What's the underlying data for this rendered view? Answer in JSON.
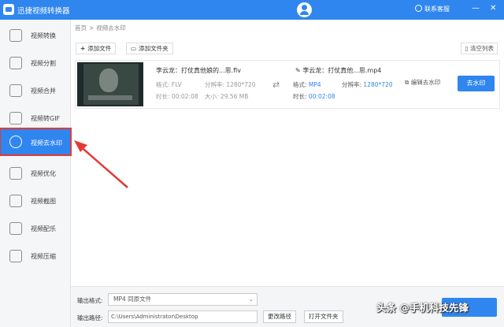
{
  "app": {
    "title": "迅捷视频转换器",
    "support_label": "联系客服",
    "win_min": "—",
    "win_close": "✕"
  },
  "sidebar": {
    "items": [
      {
        "label": "视频转换",
        "icon": "convert-icon"
      },
      {
        "label": "视频分割",
        "icon": "split-icon"
      },
      {
        "label": "视频合并",
        "icon": "merge-icon"
      },
      {
        "label": "视频转GIF",
        "icon": "gif-icon"
      },
      {
        "label": "视频去水印",
        "icon": "watermark-remove-icon",
        "active": true
      },
      {
        "label": "视频优化",
        "icon": "optimize-icon"
      },
      {
        "label": "视频截图",
        "icon": "screenshot-icon"
      },
      {
        "label": "视频配乐",
        "icon": "music-icon"
      },
      {
        "label": "视频压缩",
        "icon": "compress-icon"
      }
    ]
  },
  "breadcrumb": {
    "home": "首页",
    "sep": ">",
    "current": "视频去水印"
  },
  "toolbar": {
    "add_file": "添加文件",
    "add_folder": "添加文件夹",
    "clear_list": "清空列表"
  },
  "file": {
    "source_name": "李云龙：打仗真他娘的...思.flv",
    "format_label": "格式:",
    "format_value": "FLV",
    "resolution_label": "分辨率:",
    "resolution_value": "1280*720",
    "duration_label": "时长:",
    "duration_value": "00:02:08",
    "size_label": "大小:",
    "size_value": "29.56 MB",
    "output_name": "李云龙：打仗真他...思.mp4",
    "out_format_label": "格式:",
    "out_format_value": "MP4",
    "out_resolution_label": "分辨率:",
    "out_resolution_value": "1280*720",
    "out_duration_label": "时长:",
    "out_duration_value": "00:02:08",
    "edit_watermark": "编辑去水印",
    "remove_button": "去水印"
  },
  "bottom": {
    "format_label": "输出格式:",
    "format_value": "MP4 同原文件",
    "path_label": "输出路径:",
    "path_value": "C:\\Users\\Administrator\\Desktop",
    "change_path": "更改路径",
    "open_folder": "打开文件夹"
  },
  "watermark_text": "头条 @手机科技先锋",
  "colors": {
    "accent": "#2f86ee",
    "highlight_border": "#e53935",
    "arrow": "#e53935"
  }
}
